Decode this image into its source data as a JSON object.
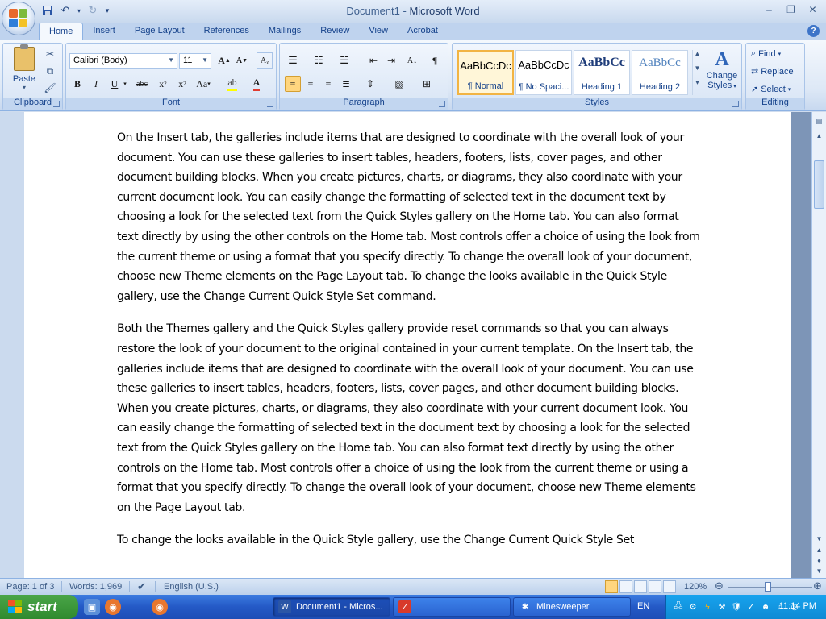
{
  "window": {
    "title_doc": "Document1",
    "title_sep": " - ",
    "title_app": "Microsoft Word",
    "minimize_icon": "minimize-icon",
    "restore_icon": "restore-icon",
    "close_icon": "close-icon"
  },
  "quick_access": [
    {
      "name": "save-icon",
      "glyph": "💾"
    },
    {
      "name": "undo-icon",
      "glyph": "↶"
    },
    {
      "name": "undo-dropdown-icon",
      "glyph": "▾"
    },
    {
      "name": "redo-icon",
      "glyph": "↻"
    },
    {
      "name": "customize-qat-icon",
      "glyph": "⁼"
    }
  ],
  "tabs": [
    "Home",
    "Insert",
    "Page Layout",
    "References",
    "Mailings",
    "Review",
    "View",
    "Acrobat"
  ],
  "active_tab": "Home",
  "ribbon": {
    "clipboard": {
      "label": "Clipboard",
      "paste_label": "Paste"
    },
    "font": {
      "label": "Font",
      "font_name": "Calibri (Body)",
      "font_size": "11"
    },
    "paragraph": {
      "label": "Paragraph"
    },
    "styles": {
      "label": "Styles",
      "gallery": [
        {
          "sample": "AaBbCcDc",
          "name": "¶ Normal",
          "active": true
        },
        {
          "sample": "AaBbCcDc",
          "name": "¶ No Spaci...",
          "active": false
        },
        {
          "sample": "AaBbCc",
          "name": "Heading 1",
          "active": false
        },
        {
          "sample": "AaBbCc",
          "name": "Heading 2",
          "active": false
        }
      ],
      "change_styles_line1": "Change",
      "change_styles_line2": "Styles"
    },
    "editing": {
      "label": "Editing",
      "find": "Find",
      "replace": "Replace",
      "select": "Select"
    }
  },
  "document": {
    "para1_before_caret": "On the Insert tab, the galleries include items that are designed to coordinate with the overall look of your document. You can use these galleries to insert tables, headers, footers, lists, cover pages, and other document building blocks. When you create pictures, charts, or diagrams, they also coordinate with your current document look. You can easily change the formatting of selected text in the document text by choosing a look for the selected text from the Quick Styles gallery on the Home tab. You can also format text directly by using the other controls on the Home tab. Most controls offer a choice of using the look from the current theme or using a format that you specify directly. To change the overall look of your document, choose new Theme elements on the Page Layout tab. To change the looks available in the Quick Style gallery, use the Change Current Quick Style Set co",
    "para1_after_caret": "mmand.",
    "para2": "Both the Themes gallery and the Quick Styles gallery provide reset commands so that you can always restore the look of your document to the original contained in your current template. On the Insert tab, the galleries include items that are designed to coordinate with the overall look of your document. You can use these galleries to insert tables, headers, footers, lists, cover pages, and other document building blocks. When you create pictures, charts, or diagrams, they also coordinate with your current document look. You can easily change the formatting of selected text in the document text by choosing a look for the selected text from the Quick Styles gallery on the Home tab. You can also format text directly by using the other controls on the Home tab. Most controls offer a choice of using the look from the current theme or using a format that you specify directly. To change the overall look of your document, choose new Theme elements on the Page Layout tab.",
    "para3": "To change the looks available in the Quick Style gallery, use the Change Current Quick Style Set"
  },
  "status": {
    "page": "Page: 1 of 3",
    "words": "Words: 1,969",
    "language": "English (U.S.)",
    "zoom": "120%"
  },
  "taskbar": {
    "start": "start",
    "tasks": [
      {
        "label": "Document1 - Micros...",
        "active": true
      },
      {
        "label": "",
        "active": false
      },
      {
        "label": "Minesweeper",
        "active": false
      }
    ],
    "language": "EN",
    "clock": "11:14 PM"
  }
}
